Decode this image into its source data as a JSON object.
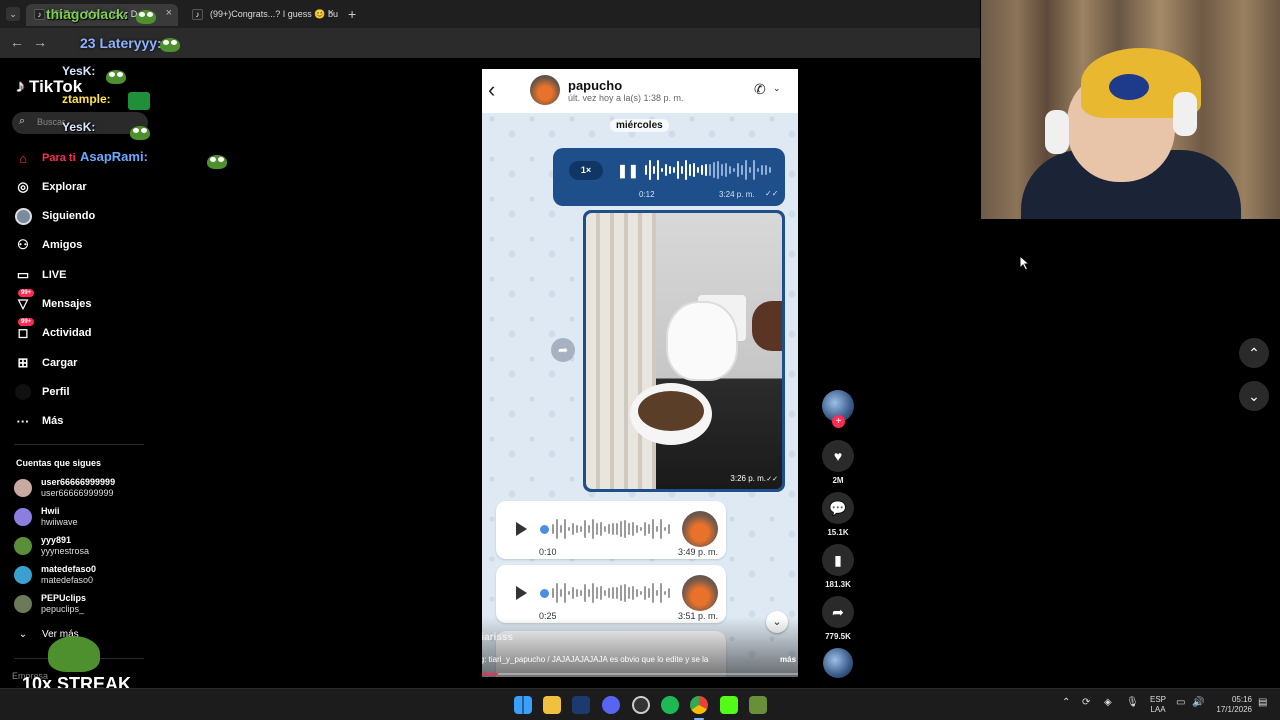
{
  "browser": {
    "tabs": [
      {
        "title": "TikTok - Make Your D...",
        "active": true
      },
      {
        "title": "(99+)Congrats...? I guess 😊 bu",
        "active": false
      }
    ],
    "new_tab": "+",
    "address_overlay": "23 Lateryyy:"
  },
  "chat": [
    {
      "user": "thiagoolack:"
    },
    {
      "user": "YesK:"
    },
    {
      "user": "ztample:"
    },
    {
      "user": "YesK:"
    },
    {
      "user": "AsapRami:"
    }
  ],
  "sidebar": {
    "logo": "TikTok",
    "search_placeholder": "Buscar",
    "nav": [
      {
        "label": "Para ti",
        "icon": "home-icon"
      },
      {
        "label": "Explorar",
        "icon": "compass-icon"
      },
      {
        "label": "Siguiendo",
        "icon": "following-icon"
      },
      {
        "label": "Amigos",
        "icon": "friends-icon"
      },
      {
        "label": "LIVE",
        "icon": "live-icon"
      },
      {
        "label": "Mensajes",
        "icon": "messages-icon",
        "badge": "99+"
      },
      {
        "label": "Actividad",
        "icon": "activity-icon",
        "badge": "99+"
      },
      {
        "label": "Cargar",
        "icon": "upload-icon"
      },
      {
        "label": "Perfil",
        "icon": "profile-icon"
      },
      {
        "label": "Más",
        "icon": "more-icon"
      }
    ],
    "following_title": "Cuentas que sigues",
    "following": [
      {
        "name": "user66666999999",
        "username": "user66666999999",
        "color": "#c9a9a0"
      },
      {
        "name": "Hwii",
        "username": "hwiiwave",
        "color": "#8a7fe0"
      },
      {
        "name": "yyy891",
        "username": "yyynestrosa",
        "color": "#5a8f3a"
      },
      {
        "name": "matedefaso0",
        "username": "matedefaso0",
        "color": "#3aa0d0"
      },
      {
        "name": "PEPUclips",
        "username": "pepuclips_",
        "color": "#6a7a5a"
      }
    ],
    "see_more": "Ver más",
    "footer": "Empresa"
  },
  "video": {
    "contact_name": "papucho",
    "contact_status": "últ. vez hoy a la(s) 1:38 p. m.",
    "day_label": "miércoles",
    "voice_out": {
      "speed": "1×",
      "duration": "0:12",
      "time": "3:24 p. m."
    },
    "photo_time": "3:26 p. m.",
    "voice_in": [
      {
        "duration": "0:10",
        "time": "3:49 p. m."
      },
      {
        "duration": "0:25",
        "time": "3:51 p. m."
      }
    ],
    "author": "tiarisss",
    "caption": "ig: tiari_y_papucho / JAJAJAJAJAJA es obvio que lo edite y se la",
    "more": "más"
  },
  "actions": {
    "likes": "2M",
    "comments": "15.1K",
    "saves": "181.3K",
    "shares": "779.5K"
  },
  "overlay": {
    "streak": "10x STREAK"
  },
  "taskbar": {
    "lang_top": "ESP",
    "lang_bottom": "LAA",
    "time": "05:16",
    "date": "17/1/2026"
  }
}
